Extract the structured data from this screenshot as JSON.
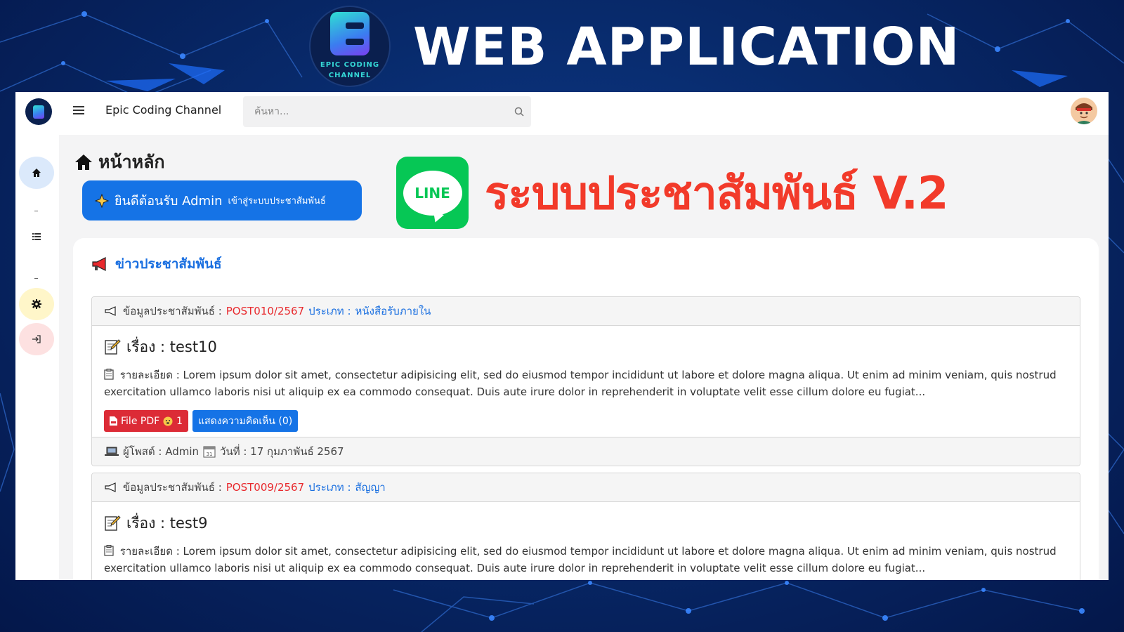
{
  "banner": {
    "logo_text_line1": "EPIC CODING",
    "logo_text_line2": "CHANNEL",
    "title": "WEB APPLICATION"
  },
  "topbar": {
    "brand": "Epic Coding Channel",
    "search_placeholder": "ค้นหา..."
  },
  "page": {
    "title": "หน้าหลัก",
    "welcome_main": "ยินดีต้อนรับ Admin",
    "welcome_sub": "เข้าสู่ระบบประชาสัมพันธ์"
  },
  "promo": {
    "line_text": "LINE",
    "title": "ระบบประชาสัมพันธ์ V.2"
  },
  "news": {
    "heading": "ข่าวประชาสัมพันธ์",
    "posts": [
      {
        "info_label": "ข้อมูลประชาสัมพันธ์ :",
        "code": "POST010/2567",
        "type_label": "ประเภท :",
        "type": "หนังสือรับภายใน",
        "subject": "เรื่อง : test10",
        "detail": "รายละเอียด : Lorem ipsum dolor sit amet, consectetur adipisicing elit, sed do eiusmod tempor incididunt ut labore et dolore magna aliqua. Ut enim ad minim veniam, quis nostrud exercitation ullamco laboris nisi ut aliquip ex ea commodo consequat. Duis aute irure dolor in reprehenderit in voluptate velit esse cillum dolore eu fugiat...",
        "pdf_label": "File PDF",
        "pdf_views": "1",
        "comment_label": "แสดงความคิดเห็น (0)",
        "poster": "ผู้โพสต์ : Admin",
        "date": "วันที่ : 17 กุมภาพันธ์ 2567"
      },
      {
        "info_label": "ข้อมูลประชาสัมพันธ์ :",
        "code": "POST009/2567",
        "type_label": "ประเภท :",
        "type": "สัญญา",
        "subject": "เรื่อง : test9",
        "detail": "รายละเอียด : Lorem ipsum dolor sit amet, consectetur adipisicing elit, sed do eiusmod tempor incididunt ut labore et dolore magna aliqua. Ut enim ad minim veniam, quis nostrud exercitation ullamco laboris nisi ut aliquip ex ea commodo consequat. Duis aute irure dolor in reprehenderit in voluptate velit esse cillum dolore eu fugiat..."
      }
    ]
  },
  "sidebar": {
    "items": [
      {
        "icon": "home-icon",
        "color": "#dbe9fb"
      },
      {
        "icon": "list-icon",
        "color": "#ffffff"
      },
      {
        "icon": "gear-icon",
        "color": "#fff6c9"
      },
      {
        "icon": "logout-icon",
        "color": "#fde1e1"
      }
    ]
  },
  "colors": {
    "primary": "#1573e6",
    "danger": "#dc2b36",
    "promo_red": "#f23a2a",
    "line_green": "#06c755"
  }
}
